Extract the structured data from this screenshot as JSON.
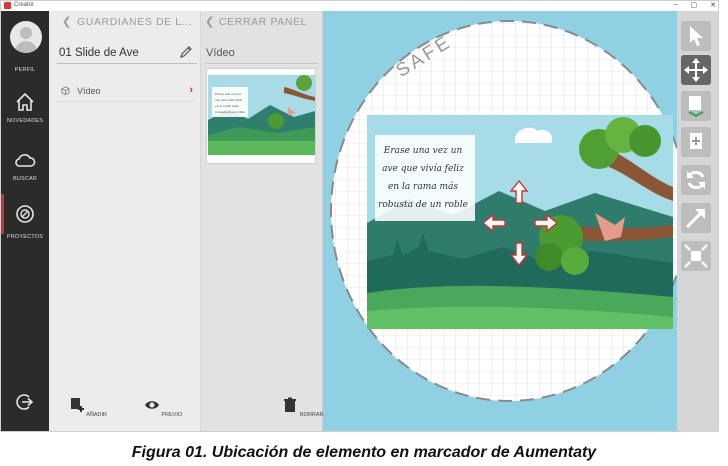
{
  "window": {
    "title": "Creator",
    "controls": [
      "–",
      "▢",
      "✕"
    ]
  },
  "sidebar": {
    "profile_label": "PERFIL",
    "items": [
      {
        "label": "NOVEDADES",
        "icon": "home-icon"
      },
      {
        "label": "BUSCAR",
        "icon": "cloud-icon"
      },
      {
        "label": "PROYECTOS",
        "icon": "projects-icon"
      }
    ],
    "logout_icon": "logout-icon"
  },
  "panel_elements": {
    "back_label": "GUARDIANES DE L...",
    "slide_name": "01 Slide de Ave",
    "element_label": "Vídeo",
    "add_label": "AÑADIR",
    "preview_label": "PREVIO"
  },
  "panel_detail": {
    "close_label": "CERRAR PANEL",
    "subtitle": "Vídeo",
    "delete_label": "BORRAR"
  },
  "canvas": {
    "safe_label": "SAFE",
    "story_lines": [
      "Erase una vez un",
      "ave que vivía feliz",
      "en la rama más",
      "robusta de un roble"
    ]
  },
  "toolbar": {
    "tools": [
      "pointer-icon",
      "move-icon",
      "layer-down-icon",
      "layer-up-icon",
      "rotate-icon",
      "resize-diagonal-icon",
      "fit-icon"
    ]
  },
  "colors": {
    "accent": "#d32f2f",
    "sidebar": "#2b2b2b",
    "canvas_bg": "#8fd0e3"
  },
  "caption": "Figura 01. Ubicación de elemento en marcador de Aumentaty"
}
